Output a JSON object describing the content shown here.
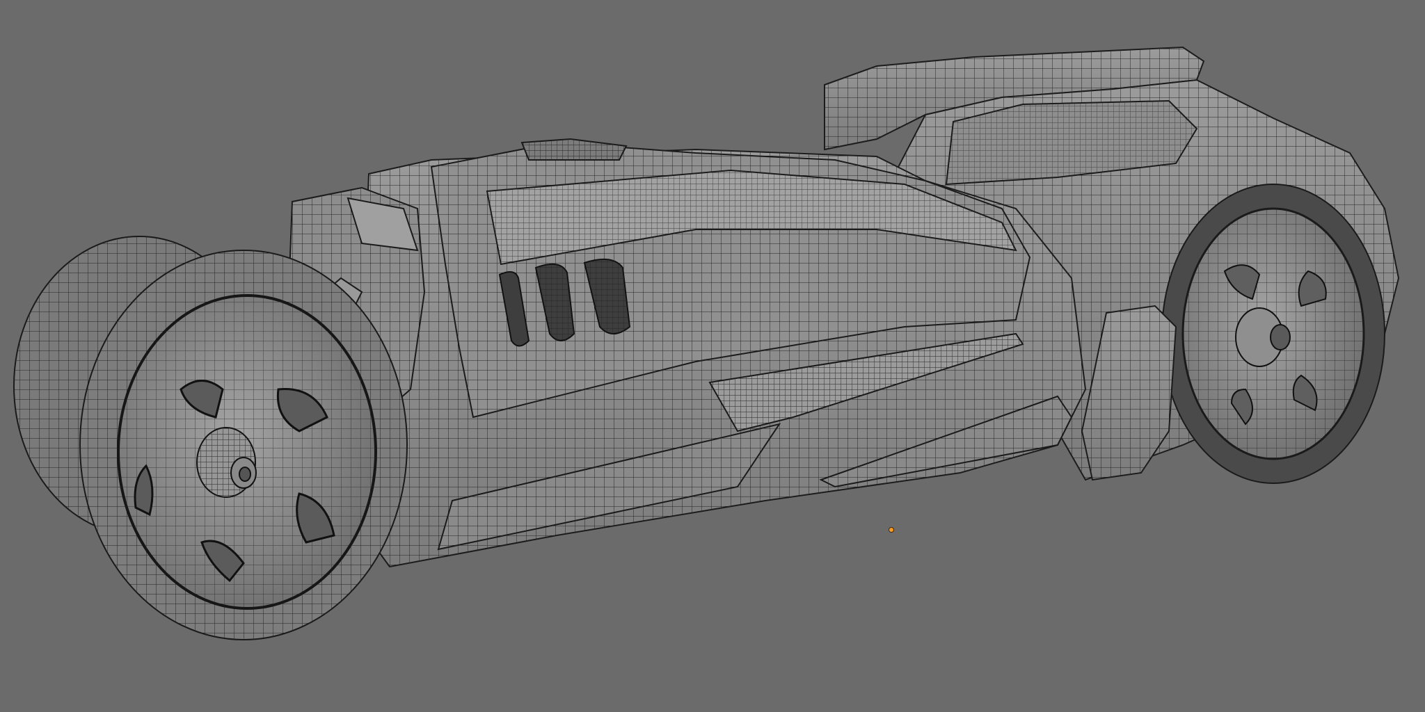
{
  "viewport": {
    "background": "#6b6b6b",
    "overlay": "wireframe",
    "object_fill": "#8a8a8a",
    "wire_color": "#1f1f1f",
    "origin_color": "#ff9a1f"
  },
  "icons": {
    "object_origin": "origin-dot-icon"
  }
}
